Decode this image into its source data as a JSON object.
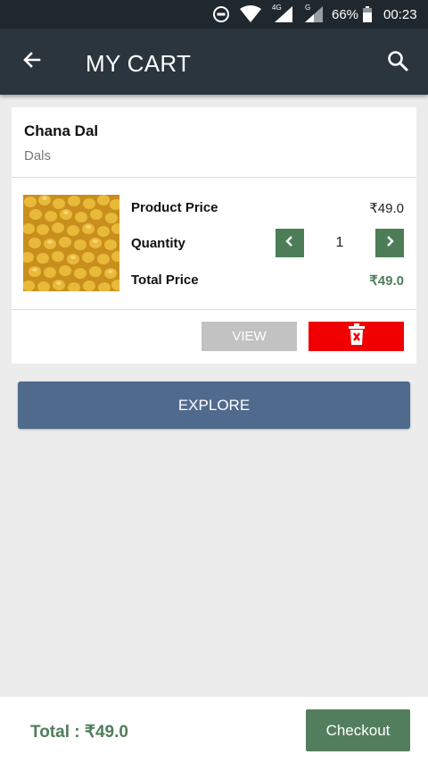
{
  "status_bar": {
    "network_4g": "4G",
    "network_g": "G",
    "battery": "66%",
    "time": "00:23",
    "icons": [
      "do-not-disturb-icon",
      "wifi-icon",
      "signal-icon",
      "signal-icon",
      "battery-icon"
    ]
  },
  "app_bar": {
    "title": "MY CART",
    "back_icon": "arrow-left-icon",
    "search_icon": "search-icon"
  },
  "cart_item": {
    "name": "Chana Dal",
    "category": "Dals",
    "product_price_label": "Product Price",
    "product_price": "₹49.0",
    "quantity_label": "Quantity",
    "quantity": "1",
    "total_price_label": "Total Price",
    "total_price": "₹49.0",
    "view_label": "VIEW",
    "delete_icon": "trash-icon"
  },
  "explore_label": "EXPLORE",
  "footer": {
    "total_label": "Total : ₹49.0",
    "checkout_label": "Checkout"
  },
  "colors": {
    "app_bar": "#2b353d",
    "accent_green": "#4f7e5a",
    "explore_blue": "#506a8e",
    "delete_red": "#f00000"
  }
}
